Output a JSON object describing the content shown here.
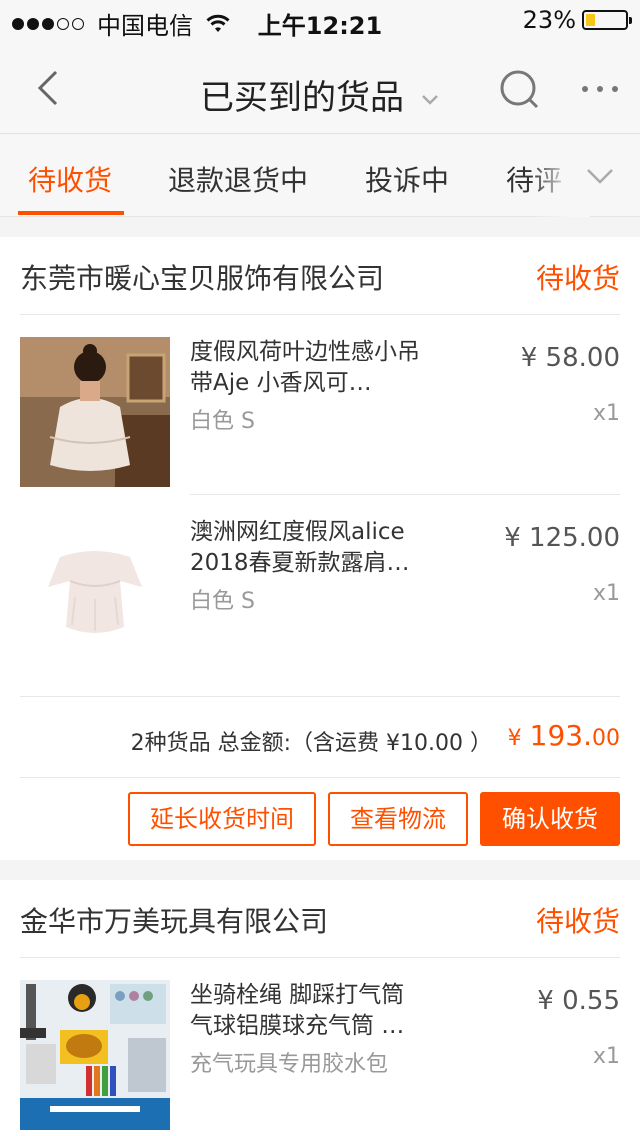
{
  "status_bar": {
    "carrier": "中国电信",
    "time": "上午12:21",
    "battery": "23%"
  },
  "nav": {
    "title": "已买到的货品",
    "icons": [
      "back-icon",
      "chevron-down-icon",
      "search-icon",
      "more-icon"
    ]
  },
  "tabs": [
    {
      "label": "待收货",
      "active": true
    },
    {
      "label": "退款退货中"
    },
    {
      "label": "投诉中"
    },
    {
      "label": "待评"
    }
  ],
  "orders": [
    {
      "shop": "东莞市暖心宝贝服饰有限公司",
      "status": "待收货",
      "items": [
        {
          "title": "度假风荷叶边性感小吊带Aje 小香风可…",
          "sku": "白色 S",
          "price": "¥ 58.00",
          "qty": "x1"
        },
        {
          "title": "澳洲网红度假风alice 2018春夏新款露肩…",
          "sku": "白色 S",
          "price": "¥ 125.00",
          "qty": "x1"
        }
      ],
      "summary": {
        "text": "2种货品 总金额:（含运费 ¥10.00 ）",
        "currency": "¥",
        "total_int": "193.",
        "total_dec": "00"
      },
      "buttons": {
        "extend": "延长收货时间",
        "logistics": "查看物流",
        "confirm": "确认收货"
      }
    },
    {
      "shop": "金华市万美玩具有限公司",
      "status": "待收货",
      "items": [
        {
          "title": "坐骑栓绳 脚踩打气筒 气球铝膜球充气筒 …",
          "sku": "充气玩具专用胶水包",
          "price": "¥ 0.55",
          "qty": "x1"
        }
      ]
    }
  ],
  "colors": {
    "accent": "#ff5000",
    "text": "#333333",
    "muted": "#999999"
  }
}
